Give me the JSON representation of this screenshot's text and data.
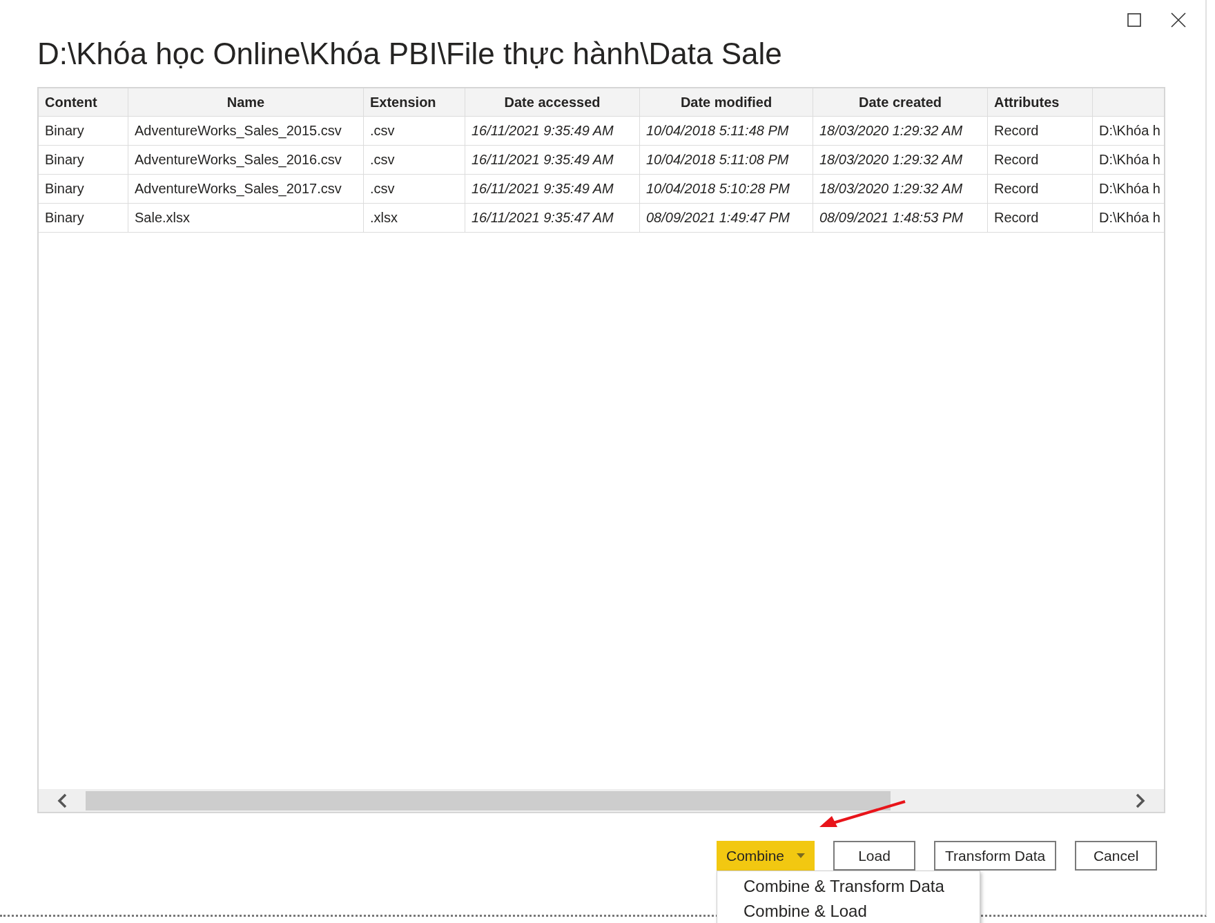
{
  "window": {
    "title": "D:\\Khóa học Online\\Khóa PBI\\File thực hành\\Data Sale"
  },
  "table": {
    "columns": [
      {
        "label": "Content",
        "kind": "label"
      },
      {
        "label": "Name",
        "kind": "name"
      },
      {
        "label": "Extension",
        "kind": "label"
      },
      {
        "label": "Date accessed",
        "kind": "date"
      },
      {
        "label": "Date modified",
        "kind": "date"
      },
      {
        "label": "Date created",
        "kind": "date"
      },
      {
        "label": "Attributes",
        "kind": "label"
      }
    ],
    "rows": [
      {
        "cells": [
          "Binary",
          "AdventureWorks_Sales_2015.csv",
          ".csv",
          "16/11/2021 9:35:49 AM",
          "10/04/2018 5:11:48 PM",
          "18/03/2020 1:29:32 AM",
          "Record",
          "D:\\Khóa h"
        ]
      },
      {
        "cells": [
          "Binary",
          "AdventureWorks_Sales_2016.csv",
          ".csv",
          "16/11/2021 9:35:49 AM",
          "10/04/2018 5:11:08 PM",
          "18/03/2020 1:29:32 AM",
          "Record",
          "D:\\Khóa h"
        ]
      },
      {
        "cells": [
          "Binary",
          "AdventureWorks_Sales_2017.csv",
          ".csv",
          "16/11/2021 9:35:49 AM",
          "10/04/2018 5:10:28 PM",
          "18/03/2020 1:29:32 AM",
          "Record",
          "D:\\Khóa h"
        ]
      },
      {
        "cells": [
          "Binary",
          "Sale.xlsx",
          ".xlsx",
          "16/11/2021 9:35:47 AM",
          "08/09/2021 1:49:47 PM",
          "08/09/2021 1:48:53 PM",
          "Record",
          "D:\\Khóa h"
        ]
      }
    ]
  },
  "buttons": [
    {
      "label": "Combine",
      "kind": "split"
    },
    {
      "label": "Load",
      "kind": "plain"
    },
    {
      "label": "Transform Data",
      "kind": "plain"
    },
    {
      "label": "Cancel",
      "kind": "plain"
    }
  ],
  "combine_menu": {
    "items": [
      "Combine & Transform Data",
      "Combine & Load"
    ]
  }
}
